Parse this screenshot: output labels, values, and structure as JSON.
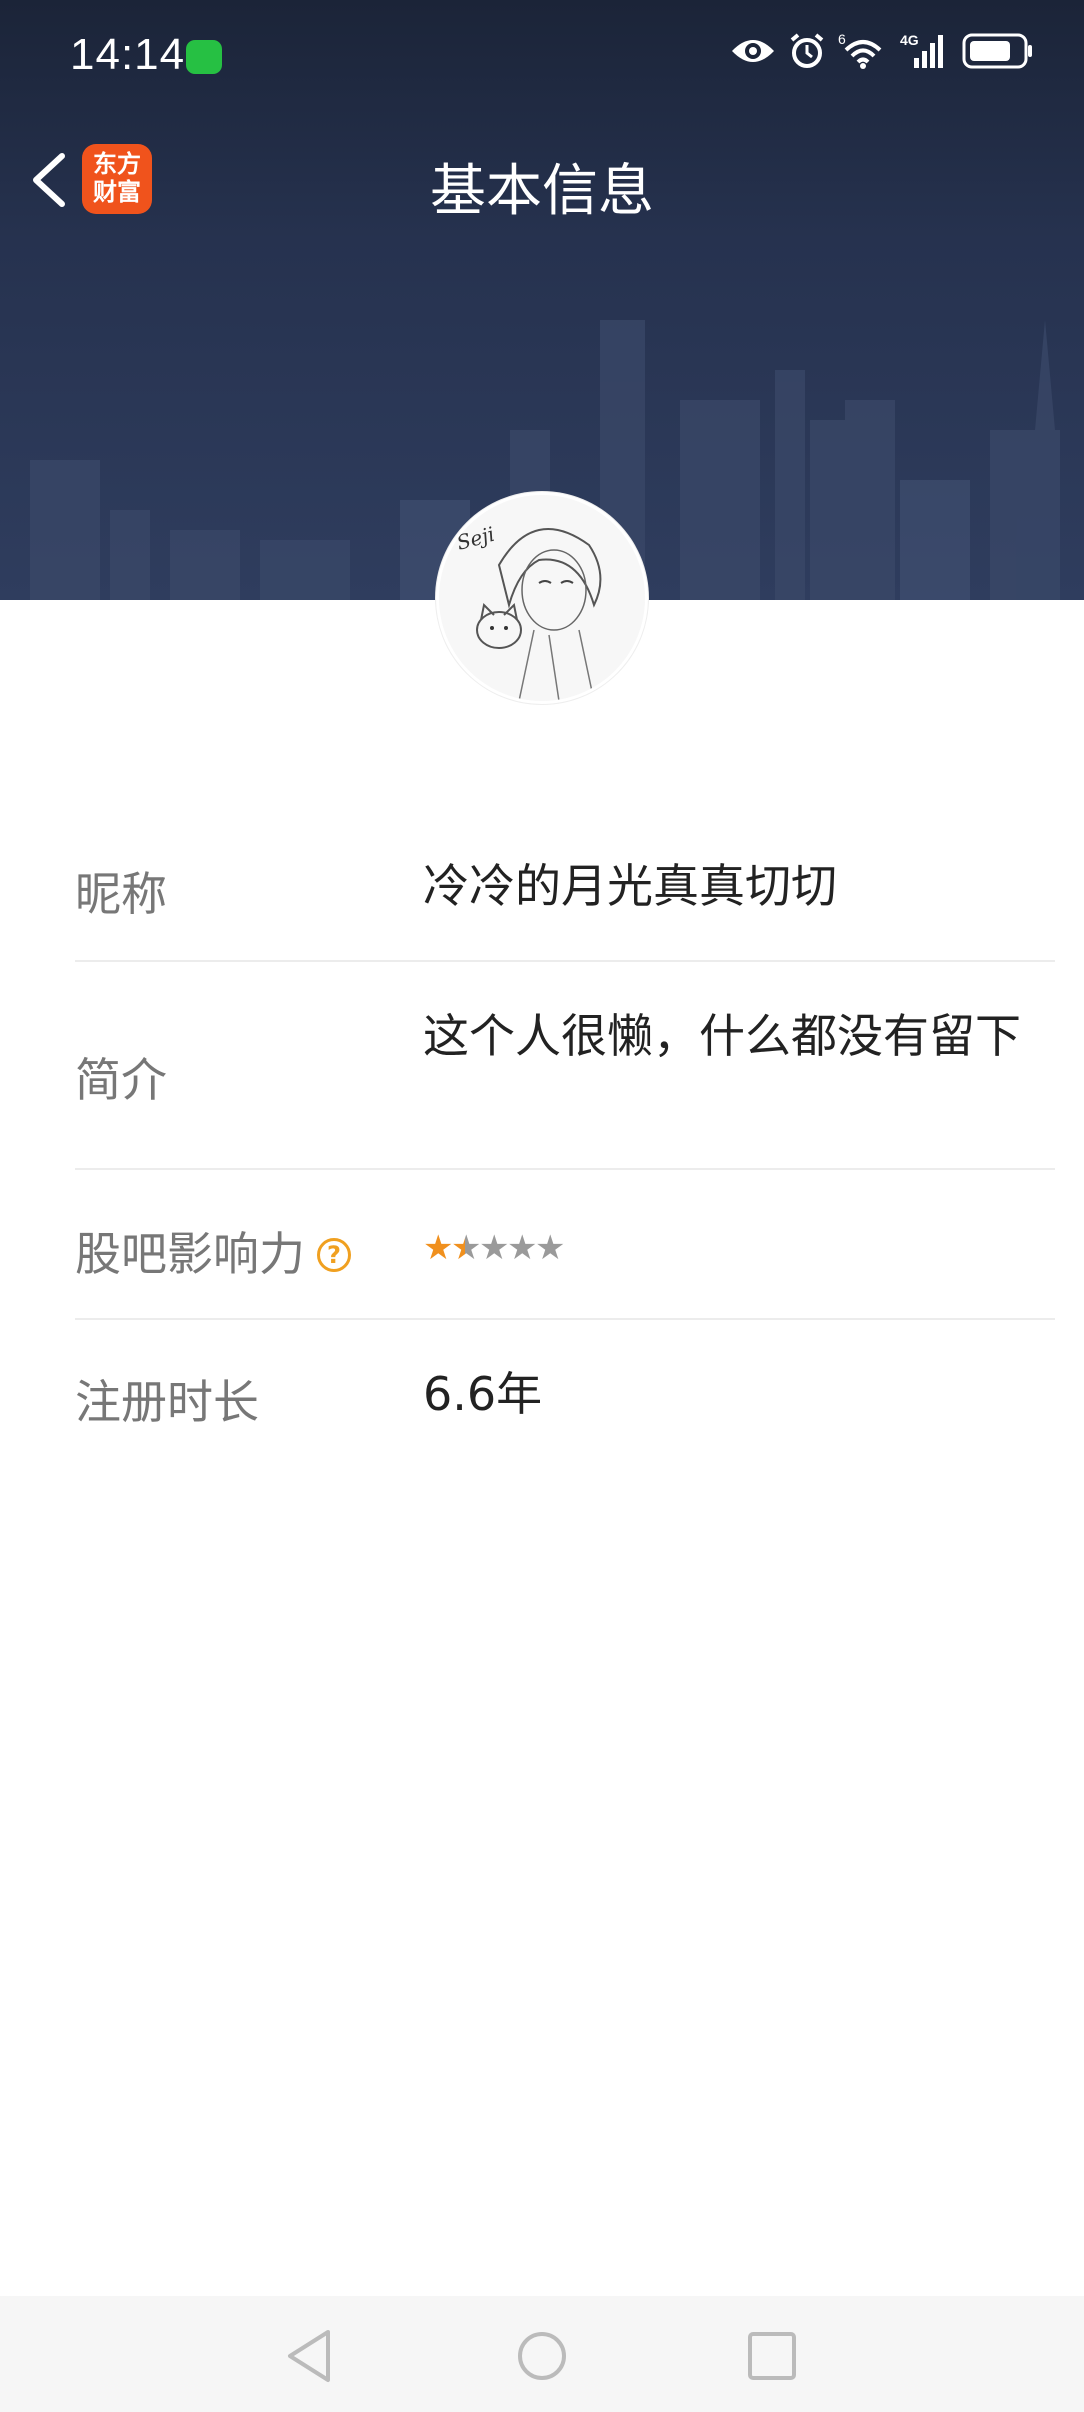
{
  "status_bar": {
    "time": "14:14",
    "icons": [
      "wechat-icon",
      "eye-icon",
      "alarm-icon",
      "wifi-icon",
      "signal-4g-icon",
      "battery-icon"
    ],
    "wifi_badge": "6",
    "network_badge": "4G"
  },
  "nav": {
    "title": "基本信息",
    "logo_line1": "东方",
    "logo_line2": "财富"
  },
  "profile": {
    "avatar_text": "Seji",
    "nickname_label": "昵称",
    "nickname": "冷冷的月光真真切切",
    "bio_label": "简介",
    "bio": "这个人很懒，什么都没有留下",
    "influence_label": "股吧影响力",
    "influence_help": "?",
    "influence_stars": 1.5,
    "influence_max": 5,
    "registration_label": "注册时长",
    "registration": "6.6年"
  },
  "colors": {
    "header_bg": "#1b2438",
    "logo_bg": "#f0531c",
    "star_active": "#f0901e",
    "star_inactive": "#9a9a9a"
  }
}
